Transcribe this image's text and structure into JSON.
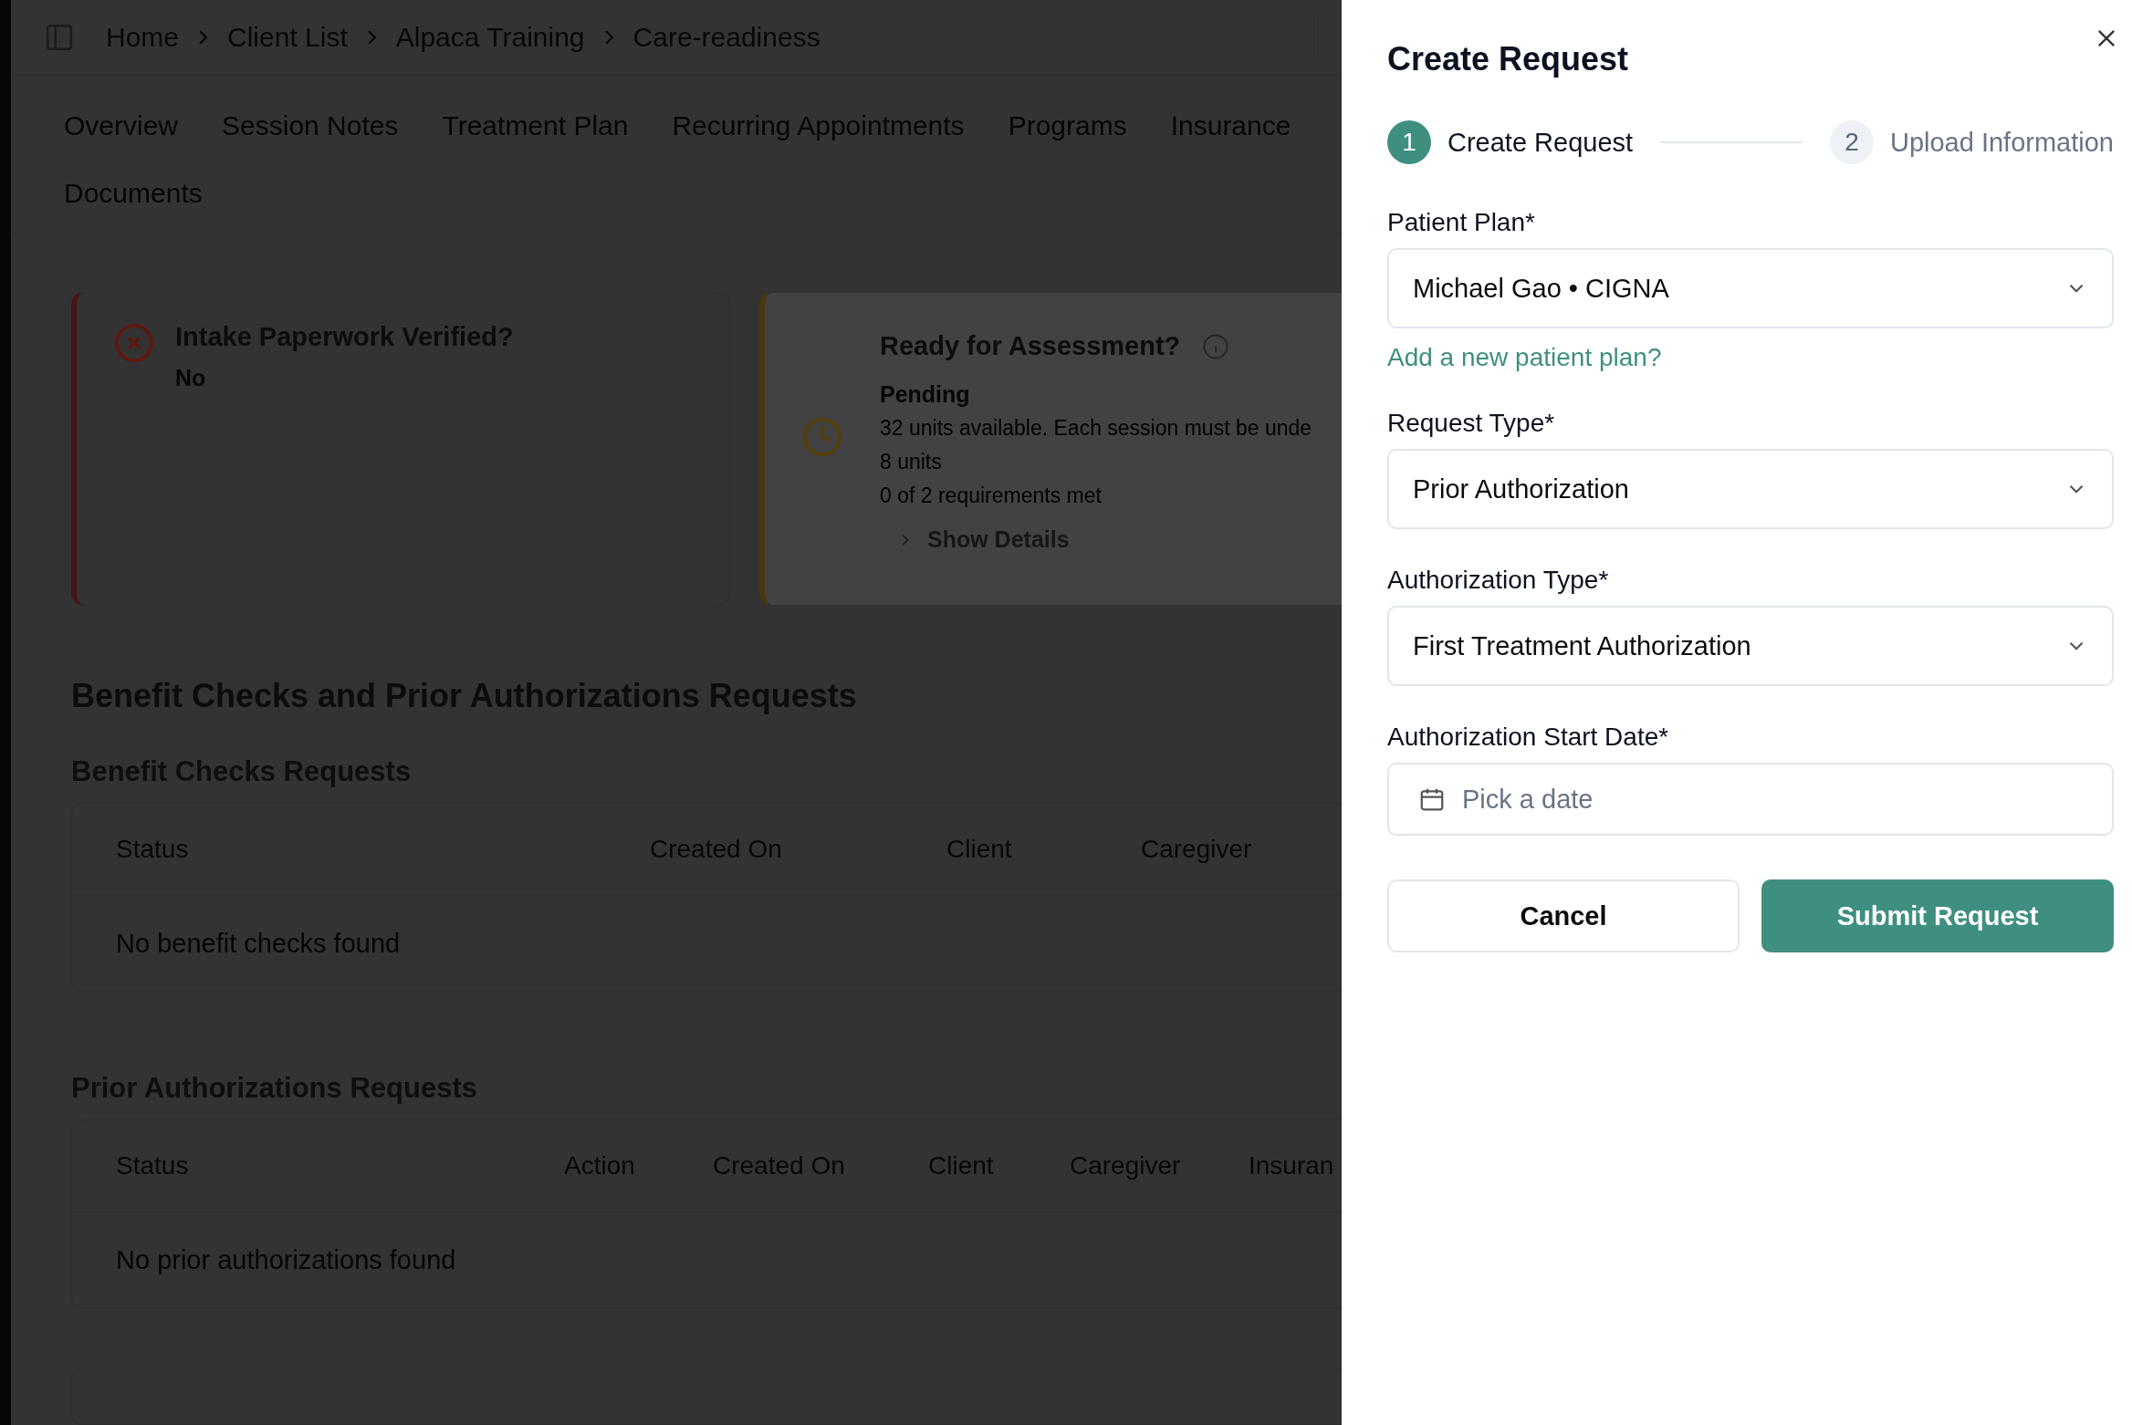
{
  "breadcrumb": [
    {
      "label": "Home"
    },
    {
      "label": "Client List"
    },
    {
      "label": "Alpaca Training"
    },
    {
      "label": "Care-readiness"
    }
  ],
  "tabs": [
    {
      "label": "Overview",
      "selected": false
    },
    {
      "label": "Session Notes",
      "selected": false
    },
    {
      "label": "Treatment Plan",
      "selected": false
    },
    {
      "label": "Recurring Appointments",
      "selected": false
    },
    {
      "label": "Programs",
      "selected": false
    },
    {
      "label": "Insurance",
      "selected": false
    },
    {
      "label": "Documents",
      "selected": false
    }
  ],
  "status_cards": [
    {
      "kind": "failed",
      "title": "Intake Paperwork Verified?",
      "status": "No"
    },
    {
      "kind": "pending",
      "title": "Ready for Assessment?",
      "status": "Pending",
      "lines": [
        "32 units available. Each session must be unde",
        "8 units",
        "0 of 2 requirements met"
      ],
      "details": "Show Details"
    }
  ],
  "section_title": "Benefit Checks and Prior Authorizations Requests",
  "tables": [
    {
      "title": "Benefit Checks Requests",
      "columns": [
        "Status",
        "Created On",
        "Client",
        "Caregiver"
      ],
      "empty": "No benefit checks found"
    },
    {
      "title": "Prior Authorizations Requests",
      "columns": [
        "Status",
        "Action",
        "Created On",
        "Client",
        "Caregiver",
        "Insuran"
      ],
      "empty": "No prior authorizations found"
    }
  ],
  "dialog": {
    "title": "Create Request",
    "steps": [
      {
        "number": "1",
        "label": "Create Request",
        "selected": true
      },
      {
        "number": "2",
        "label": "Upload Information",
        "selected": false
      }
    ],
    "fields": [
      {
        "kind": "select",
        "label": "Patient Plan*",
        "value": "Michael Gao • CIGNA",
        "link": "Add a new patient plan?"
      },
      {
        "kind": "select",
        "label": "Request Type*",
        "value": "Prior Authorization"
      },
      {
        "kind": "select",
        "label": "Authorization Type*",
        "value": "First Treatment Authorization"
      },
      {
        "kind": "date",
        "label": "Authorization Start Date*",
        "placeholder": "Pick a date"
      }
    ],
    "buttons": [
      {
        "kind": "secondary",
        "label": "Cancel"
      },
      {
        "kind": "primary",
        "label": "Submit Request"
      }
    ]
  }
}
